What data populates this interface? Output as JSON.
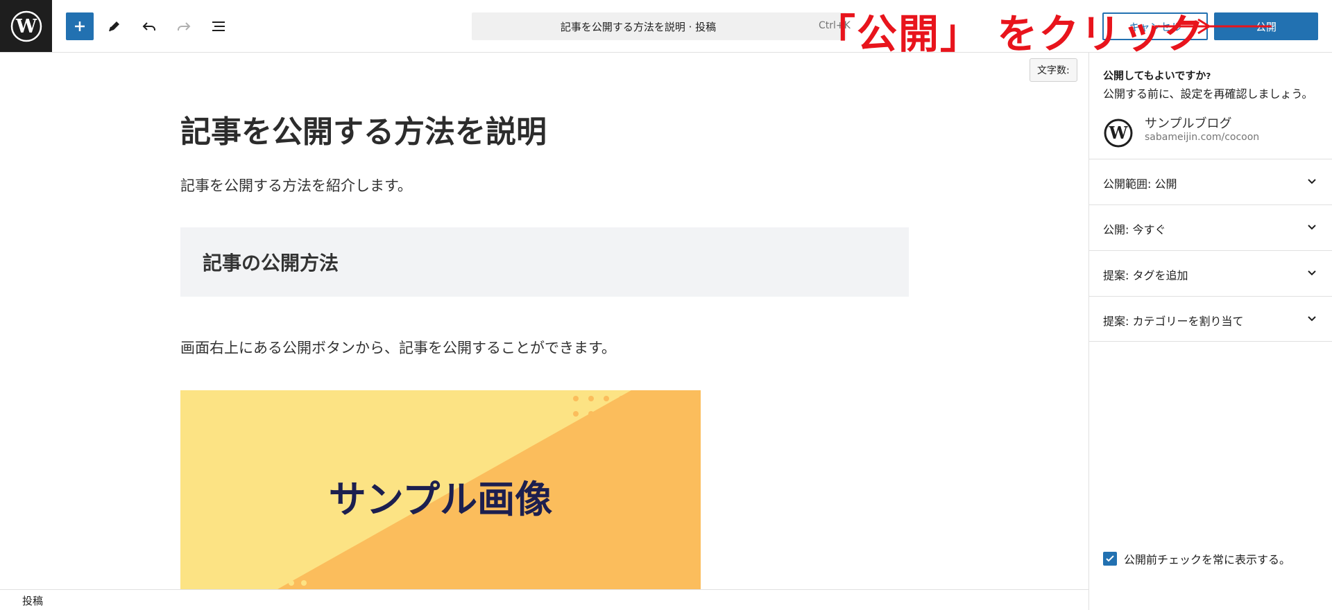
{
  "header": {
    "command_title": "記事を公開する方法を説明 · 投稿",
    "command_shortcut": "Ctrl+K",
    "cancel_label": "キャンセル",
    "publish_label": "公開"
  },
  "annotation": {
    "text": "「公開」 をクリック",
    "color": "#e8141c"
  },
  "editor": {
    "word_count_label": "文字数:",
    "title": "記事を公開する方法を説明",
    "paragraph_1": "記事を公開する方法を紹介します。",
    "heading_2": "記事の公開方法",
    "paragraph_2": "画面右上にある公開ボタンから、記事を公開することができます。",
    "image_text": "サンプル画像"
  },
  "statusbar": {
    "label": "投稿"
  },
  "sidebar": {
    "question": "公開してもよいですか",
    "question_mark": "?",
    "description": "公開する前に、設定を再確認しましょう。",
    "site_name": "サンプルブログ",
    "site_url": "sabameijin.com/cocoon",
    "panels": [
      {
        "label": "公開範囲: 公開"
      },
      {
        "label": "公開: 今すぐ"
      },
      {
        "label": "提案: タグを追加"
      },
      {
        "label": "提案: カテゴリーを割り当て"
      }
    ],
    "always_show_label": "公開前チェックを常に表示する。"
  },
  "colors": {
    "accent": "#2271b1",
    "image_yellow": "#fce384",
    "image_orange": "#fbbd5c",
    "image_text": "#1c1f4f"
  },
  "icons": [
    "wordpress-logo-icon",
    "plus-icon",
    "pencil-icon",
    "undo-icon",
    "redo-icon",
    "list-view-icon",
    "chevron-down-icon",
    "checkmark-icon"
  ]
}
